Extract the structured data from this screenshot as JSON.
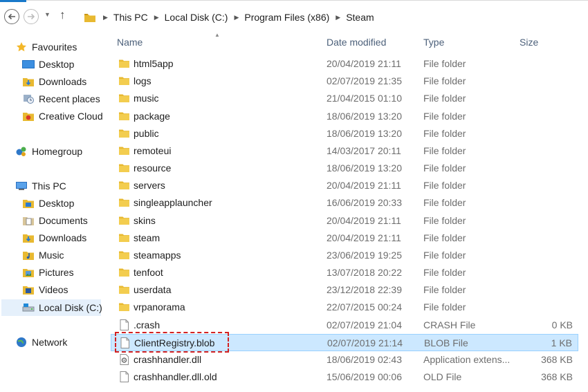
{
  "address": {
    "crumbs": [
      "This PC",
      "Local Disk (C:)",
      "Program Files (x86)",
      "Steam"
    ]
  },
  "columns": {
    "name": "Name",
    "date": "Date modified",
    "type": "Type",
    "size": "Size"
  },
  "sidebar": {
    "favourites": "Favourites",
    "fav_items": [
      "Desktop",
      "Downloads",
      "Recent places",
      "Creative Cloud"
    ],
    "homegroup": "Homegroup",
    "thispc": "This PC",
    "pc_items": [
      "Desktop",
      "Documents",
      "Downloads",
      "Music",
      "Pictures",
      "Videos",
      "Local Disk (C:)"
    ],
    "network": "Network"
  },
  "files": [
    {
      "name": "html5app",
      "date": "20/04/2019 21:11",
      "type": "File folder",
      "size": "",
      "icon": "folder-icon"
    },
    {
      "name": "logs",
      "date": "02/07/2019 21:35",
      "type": "File folder",
      "size": "",
      "icon": "folder-icon"
    },
    {
      "name": "music",
      "date": "21/04/2015 01:10",
      "type": "File folder",
      "size": "",
      "icon": "folder-icon"
    },
    {
      "name": "package",
      "date": "18/06/2019 13:20",
      "type": "File folder",
      "size": "",
      "icon": "folder-icon"
    },
    {
      "name": "public",
      "date": "18/06/2019 13:20",
      "type": "File folder",
      "size": "",
      "icon": "folder-icon"
    },
    {
      "name": "remoteui",
      "date": "14/03/2017 20:11",
      "type": "File folder",
      "size": "",
      "icon": "folder-icon"
    },
    {
      "name": "resource",
      "date": "18/06/2019 13:20",
      "type": "File folder",
      "size": "",
      "icon": "folder-icon"
    },
    {
      "name": "servers",
      "date": "20/04/2019 21:11",
      "type": "File folder",
      "size": "",
      "icon": "folder-icon"
    },
    {
      "name": "singleapplauncher",
      "date": "16/06/2019 20:33",
      "type": "File folder",
      "size": "",
      "icon": "folder-icon"
    },
    {
      "name": "skins",
      "date": "20/04/2019 21:11",
      "type": "File folder",
      "size": "",
      "icon": "folder-icon"
    },
    {
      "name": "steam",
      "date": "20/04/2019 21:11",
      "type": "File folder",
      "size": "",
      "icon": "folder-icon"
    },
    {
      "name": "steamapps",
      "date": "23/06/2019 19:25",
      "type": "File folder",
      "size": "",
      "icon": "folder-icon"
    },
    {
      "name": "tenfoot",
      "date": "13/07/2018 20:22",
      "type": "File folder",
      "size": "",
      "icon": "folder-icon"
    },
    {
      "name": "userdata",
      "date": "23/12/2018 22:39",
      "type": "File folder",
      "size": "",
      "icon": "folder-icon"
    },
    {
      "name": "vrpanorama",
      "date": "22/07/2015 00:24",
      "type": "File folder",
      "size": "",
      "icon": "folder-icon"
    },
    {
      "name": ".crash",
      "date": "02/07/2019 21:04",
      "type": "CRASH File",
      "size": "0 KB",
      "icon": "file-icon"
    },
    {
      "name": "ClientRegistry.blob",
      "date": "02/07/2019 21:14",
      "type": "BLOB File",
      "size": "1 KB",
      "icon": "file-icon",
      "selected": true
    },
    {
      "name": "crashhandler.dll",
      "date": "18/06/2019 02:43",
      "type": "Application extens...",
      "size": "368 KB",
      "icon": "dll-icon"
    },
    {
      "name": "crashhandler.dll.old",
      "date": "15/06/2019 00:06",
      "type": "OLD File",
      "size": "368 KB",
      "icon": "file-icon"
    }
  ],
  "colors": {
    "selection": "#cce8ff",
    "selection_border": "#99d1ff",
    "highlight": "#d32121",
    "folder": "#e8b931"
  }
}
